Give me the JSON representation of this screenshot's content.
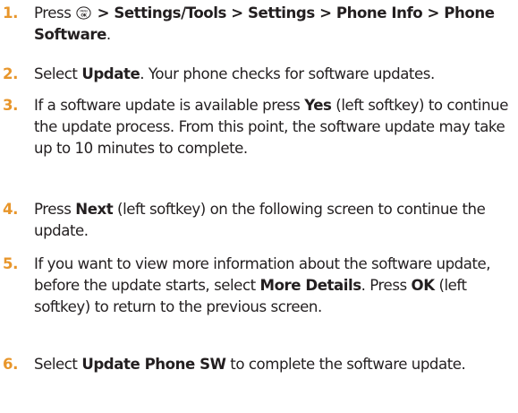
{
  "accent_color": "#e8962b",
  "steps": [
    {
      "number": "1.",
      "parts": [
        {
          "t": "Press ",
          "b": false
        },
        {
          "icon": "menu-ok-key-icon",
          "label": "MENU OK"
        },
        {
          "t": " > Settings/Tools > Settings > Phone Info > Phone Software",
          "b": true
        },
        {
          "t": ".",
          "b": false
        }
      ]
    },
    {
      "number": "2.",
      "parts": [
        {
          "t": "Select ",
          "b": false
        },
        {
          "t": "Update",
          "b": true
        },
        {
          "t": ". Your phone checks for software updates.",
          "b": false
        }
      ]
    },
    {
      "number": "3.",
      "parts": [
        {
          "t": "If a software update is available press ",
          "b": false
        },
        {
          "t": "Yes",
          "b": true
        },
        {
          "t": " (left softkey) to continue the update process. From this point, the software update may take up to 10 minutes to complete.",
          "b": false
        }
      ]
    },
    {
      "number": "4.",
      "parts": [
        {
          "t": "Press ",
          "b": false
        },
        {
          "t": "Next",
          "b": true
        },
        {
          "t": " (left softkey) on the following screen to continue the update.",
          "b": false
        }
      ]
    },
    {
      "number": "5.",
      "parts": [
        {
          "t": "If you want to view more information about the software update, before the update starts, select ",
          "b": false
        },
        {
          "t": "More Details",
          "b": true
        },
        {
          "t": ". Press ",
          "b": false
        },
        {
          "t": "OK",
          "b": true
        },
        {
          "t": " (left softkey) to return to the previous screen.",
          "b": false
        }
      ]
    },
    {
      "number": "6.",
      "parts": [
        {
          "t": "Select ",
          "b": false
        },
        {
          "t": "Update Phone SW",
          "b": true
        },
        {
          "t": " to complete the software update.",
          "b": false
        }
      ]
    }
  ]
}
